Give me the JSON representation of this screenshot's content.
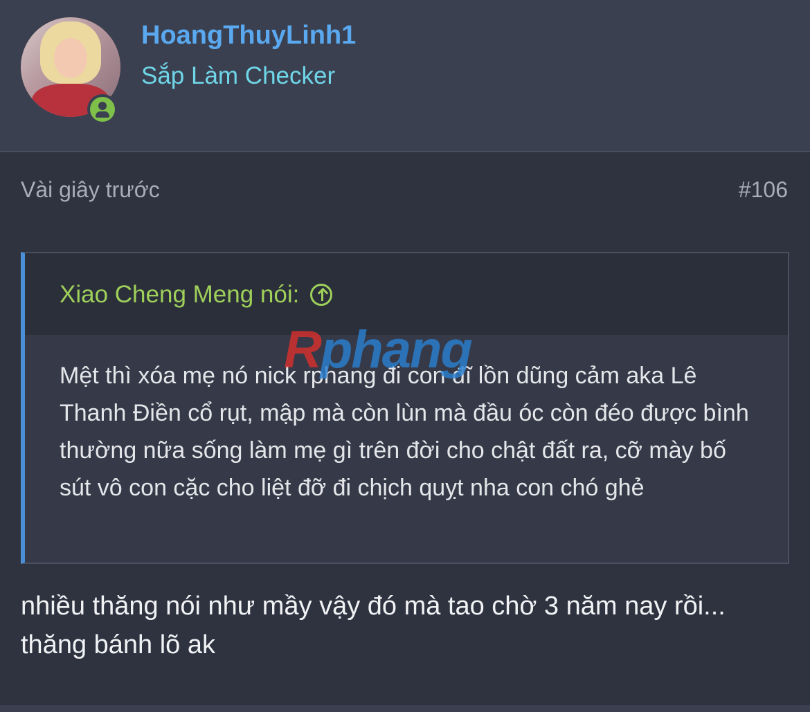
{
  "user": {
    "name": "HoangThuyLinh1",
    "title": "Sắp Làm Checker"
  },
  "post": {
    "time": "Vài giây trước",
    "number": "#106"
  },
  "quote": {
    "author": "Xiao Cheng Meng nói:",
    "body": "Mệt thì xóa mẹ nó nick rphang đi con đĩ lồn dũng cảm aka Lê Thanh Điền cổ rụt, mập mà còn lùn mà đầu óc còn đéo được bình thường nữa sống làm mẹ gì trên đời cho chật đất ra, cỡ mày bố sút vô con cặc cho liệt đỡ đi chịch quỵt nha con chó ghẻ"
  },
  "reply": {
    "text": "nhiều thăng nói như mầy vậy đó mà tao chờ 3 năm nay rồi... thăng bánh lõ ak"
  },
  "watermark": {
    "first": "R",
    "rest": "phang"
  },
  "icons": {
    "status": "user-online-icon",
    "quote_jump": "arrow-up-circle-icon"
  },
  "colors": {
    "username": "#5aa9f0",
    "user_title": "#6fd6e8",
    "quote_author": "#9fd05a",
    "quote_bar": "#4a90d9",
    "online": "#7ec04a"
  }
}
